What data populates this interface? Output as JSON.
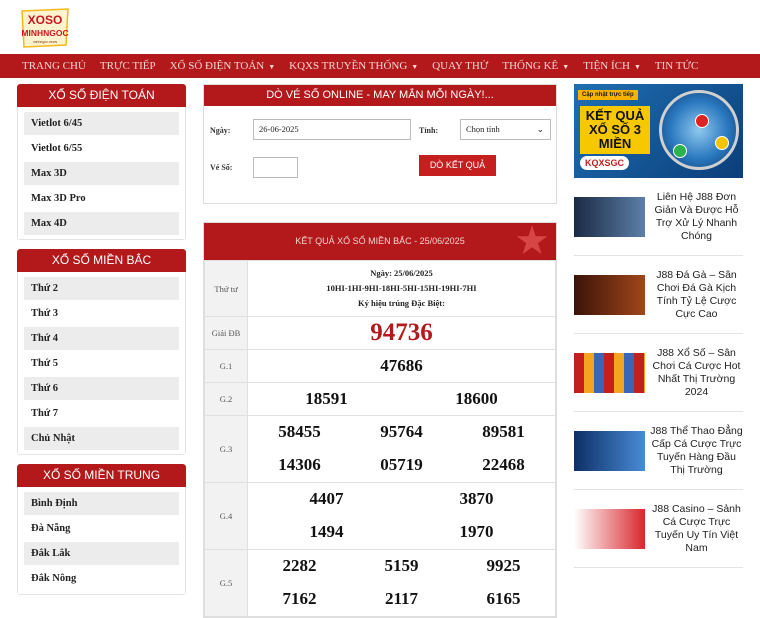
{
  "logo": {
    "line1": "XOSO",
    "line2": "MINHNGOC",
    "tagline": "minhngoc.news"
  },
  "nav": [
    {
      "label": "TRANG CHỦ",
      "dropdown": false
    },
    {
      "label": "TRỰC TIẾP",
      "dropdown": false
    },
    {
      "label": "XỔ SỐ ĐIỆN TOÁN",
      "dropdown": true
    },
    {
      "label": "KQXS TRUYỀN THỐNG",
      "dropdown": true
    },
    {
      "label": "QUAY THỬ",
      "dropdown": false
    },
    {
      "label": "THỐNG KÊ",
      "dropdown": true
    },
    {
      "label": "TIỆN ÍCH",
      "dropdown": true
    },
    {
      "label": "TIN TỨC",
      "dropdown": false
    }
  ],
  "sidebar": {
    "dien_toan": {
      "title": "XỔ SỐ ĐIỆN TOÁN",
      "items": [
        "Vietlot 6/45",
        "Vietlot 6/55",
        "Max 3D",
        "Max 3D Pro",
        "Max 4D"
      ]
    },
    "mien_bac": {
      "title": "XỔ SỐ MIỀN BẮC",
      "items": [
        "Thứ 2",
        "Thứ 3",
        "Thứ 4",
        "Thứ 5",
        "Thứ 6",
        "Thứ 7",
        "Chủ Nhật"
      ]
    },
    "mien_trung": {
      "title": "XỔ SỐ MIỀN TRUNG",
      "items": [
        "Bình Định",
        "Đà Nẵng",
        "Đắk Lắk",
        "Đắk Nông"
      ]
    }
  },
  "form": {
    "title": "DÒ VÉ SỐ ONLINE - MAY MẮN MỖI NGÀY!...",
    "date_label": "Ngày:",
    "date_value": "26-06-2025",
    "province_label": "Tỉnh:",
    "province_value": "Chọn tỉnh",
    "ticket_label": "Vé Số:",
    "ticket_value": "",
    "submit": "DÒ KẾT QUẢ"
  },
  "results": {
    "title": "KẾT QUẢ XỔ SỐ MIỀN BẮC - 25/06/2025",
    "day": "Thứ tư",
    "date_line": "Ngày: 25/06/2025",
    "codes": "10HI-1HI-9HI-18HI-5HI-15HI-19HI-7HI",
    "note": "Ký hiệu trúng Đặc Biệt:",
    "prizes": [
      {
        "label": "Giải ĐB",
        "numbers": [
          "94736"
        ]
      },
      {
        "label": "G.1",
        "numbers": [
          "47686"
        ]
      },
      {
        "label": "G.2",
        "numbers": [
          "18591",
          "18600"
        ]
      },
      {
        "label": "G.3",
        "numbers": [
          "58455",
          "95764",
          "89581",
          "14306",
          "05719",
          "22468"
        ]
      },
      {
        "label": "G.4",
        "numbers": [
          "4407",
          "3870",
          "1494",
          "1970"
        ]
      },
      {
        "label": "G.5",
        "numbers": [
          "2282",
          "5159",
          "9925",
          "7162",
          "2117",
          "6165"
        ]
      }
    ]
  },
  "right": {
    "banner": {
      "tag": "Cập nhật trực tiếp",
      "headline": "KẾT QUẢ XỔ SỐ 3 MIỀN",
      "logo": "KQXSGC"
    },
    "news": [
      "Liên Hệ J88 Đơn Giản Và Được Hỗ Trợ Xử Lý Nhanh Chóng",
      "J88 Đá Gà – Sân Chơi Đá Gà Kịch Tính Tỷ Lệ Cược Cực Cao",
      "J88 Xổ Số – Sân Chơi Cá Cược Hot Nhất Thị Trường 2024",
      "J88 Thể Thao Đẳng Cấp Cá Cược Trực Tuyến Hàng Đầu Thị Trường",
      "J88 Casino – Sảnh Cá Cược Trực Tuyến Uy Tín Việt Nam"
    ]
  }
}
